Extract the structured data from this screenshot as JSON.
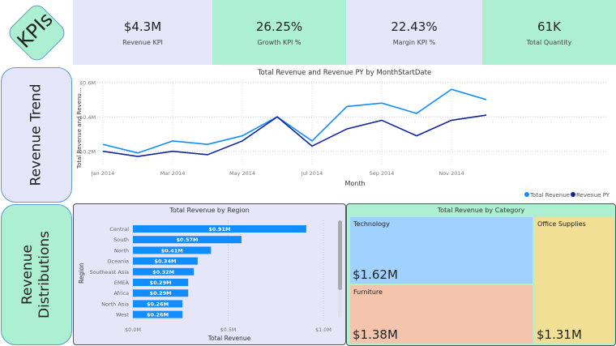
{
  "logo": {
    "label": "KPIs"
  },
  "kpis": [
    {
      "value": "$4.3M",
      "label": "Revenue KPI"
    },
    {
      "value": "26.25%",
      "label": "Growth KPI %"
    },
    {
      "value": "22.43%",
      "label": "Margin KPI %"
    },
    {
      "value": "61K",
      "label": "Total Quantity"
    }
  ],
  "sections": {
    "trend": "Revenue Trend",
    "dist_line1": "Revenue",
    "dist_line2": "Distributions"
  },
  "colors": {
    "lavender": "#e6e6fa",
    "green": "#adefd1",
    "total_revenue": "#118dff",
    "revenue_py": "#12239e"
  },
  "chart_data": [
    {
      "type": "line",
      "title": "Total Revenue and Revenue PY by MonthStartDate",
      "xlabel": "Month",
      "ylabel": "Total Revenue and Revenu...",
      "x": [
        "Jan 2014",
        "Feb 2014",
        "Mar 2014",
        "Apr 2014",
        "May 2014",
        "Jun 2014",
        "Jul 2014",
        "Aug 2014",
        "Sep 2014",
        "Oct 2014",
        "Nov 2014",
        "Dec 2014"
      ],
      "x_tick_labels": [
        "Jan 2014",
        "Mar 2014",
        "May 2014",
        "Jul 2014",
        "Sep 2014",
        "Nov 2014"
      ],
      "y_tick_labels": [
        "$0.2M",
        "$0.4M",
        "$0.6M"
      ],
      "ylim": [
        0.1,
        0.6
      ],
      "grid": true,
      "legend": "bottom-right",
      "series": [
        {
          "name": "Total Revenue",
          "color": "#118dff",
          "values": [
            0.24,
            0.19,
            0.26,
            0.24,
            0.29,
            0.4,
            0.26,
            0.46,
            0.48,
            0.42,
            0.56,
            0.5
          ]
        },
        {
          "name": "Revenue PY",
          "color": "#12239e",
          "values": [
            0.2,
            0.17,
            0.2,
            0.18,
            0.26,
            0.4,
            0.23,
            0.33,
            0.38,
            0.29,
            0.38,
            0.41
          ]
        }
      ]
    },
    {
      "type": "bar",
      "orientation": "horizontal",
      "title": "Total Revenue by Region",
      "xlabel": "Total Revenue",
      "ylabel": "Region",
      "categories": [
        "Central",
        "South",
        "North",
        "Oceania",
        "Southeast Asia",
        "EMEA",
        "Africa",
        "North Asia",
        "West"
      ],
      "values": [
        0.91,
        0.57,
        0.41,
        0.34,
        0.32,
        0.29,
        0.29,
        0.26,
        0.26
      ],
      "data_labels": [
        "$0.91M",
        "$0.57M",
        "$0.41M",
        "$0.34M",
        "$0.32M",
        "$0.29M",
        "$0.29M",
        "$0.26M",
        "$0.26M"
      ],
      "x_tick_labels": [
        "$0.0M",
        "$0.5M",
        "$1.0M"
      ],
      "xlim": [
        0,
        1.0
      ],
      "color": "#118dff"
    },
    {
      "type": "treemap",
      "title": "Total Revenue by Category",
      "items": [
        {
          "label": "Technology",
          "value": "$1.62M",
          "color": "#a0d1ff"
        },
        {
          "label": "Furniture",
          "value": "$1.38M",
          "color": "#f4c4ad"
        },
        {
          "label": "Office Supplies",
          "value": "$1.31M",
          "color": "#f0df95"
        }
      ]
    }
  ]
}
